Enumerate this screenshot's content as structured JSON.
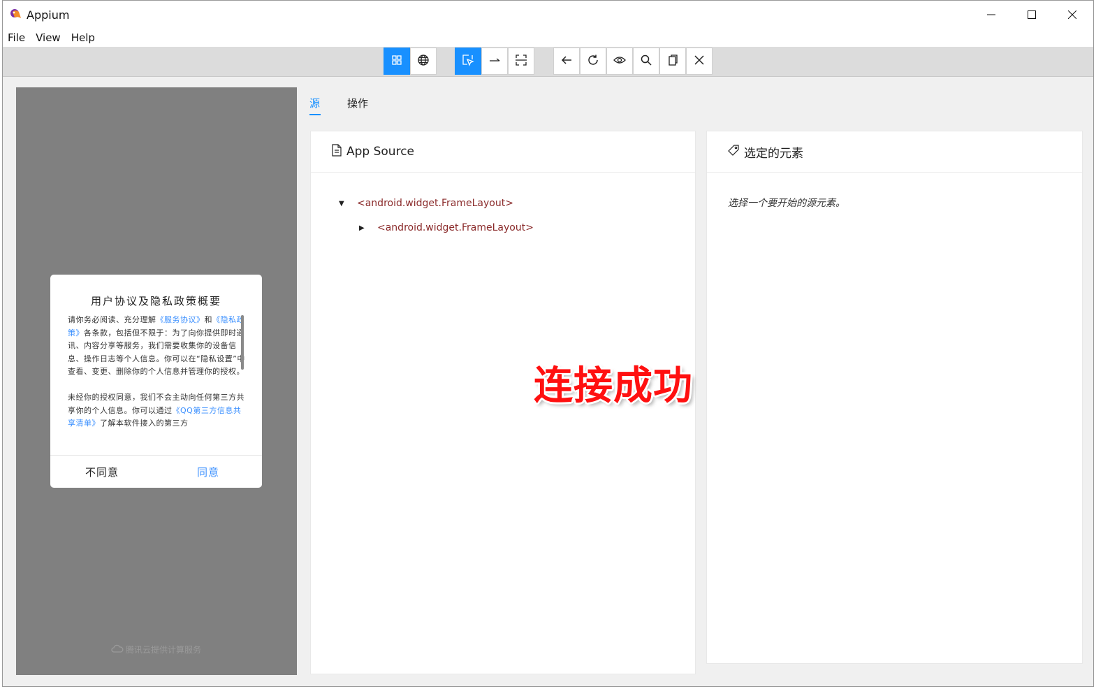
{
  "window": {
    "title": "Appium",
    "controls": {
      "minimize": "minimize-icon",
      "maximize": "maximize-icon",
      "close": "close-icon"
    }
  },
  "menu": {
    "items": [
      "File",
      "View",
      "Help"
    ]
  },
  "toolbar": {
    "groups": [
      [
        "grid-icon",
        "globe-icon"
      ],
      [
        "select-element-icon",
        "swipe-icon",
        "tap-coordinates-icon"
      ],
      [
        "back-icon",
        "refresh-icon",
        "eye-icon",
        "search-icon",
        "copy-xml-icon",
        "quit-session-icon"
      ]
    ],
    "active": [
      "grid-icon",
      "select-element-icon"
    ],
    "accent": "#1890ff"
  },
  "device": {
    "dialog": {
      "title": "用户协议及隐私政策概要",
      "p1_a": "请你务必阅读、充分理解",
      "p1_link1": "《服务协议》",
      "p1_b": "和",
      "p1_link2": "《隐私政策》",
      "p1_c": "各条款，包括但不限于：为了向你提供即时通讯、内容分享等服务，我们需要收集你的设备信息、操作日志等个人信息。你可以在“隐私设置”中查看、变更、删除你的个人信息并管理你的授权。",
      "p2_a": "未经你的授权同意，我们不会主动向任何第三方共享你的个人信息。你可以通过",
      "p2_link": "《QQ第三方信息共享清单》",
      "p2_b": "了解本软件接入的第三方",
      "disagree": "不同意",
      "agree": "同意"
    },
    "footer": "腾讯云提供计算服务"
  },
  "tabs": {
    "source": "源",
    "actions": "操作"
  },
  "source_panel": {
    "title": "App Source",
    "nodes": [
      {
        "label": "<android.widget.FrameLayout>",
        "expanded": true
      },
      {
        "label": "<android.widget.FrameLayout>",
        "expanded": false
      }
    ]
  },
  "selected_panel": {
    "title": "选定的元素",
    "hint": "选择一个要开始的源元素。"
  },
  "overlay": {
    "text": "连接成功",
    "color": "#ff1010"
  }
}
